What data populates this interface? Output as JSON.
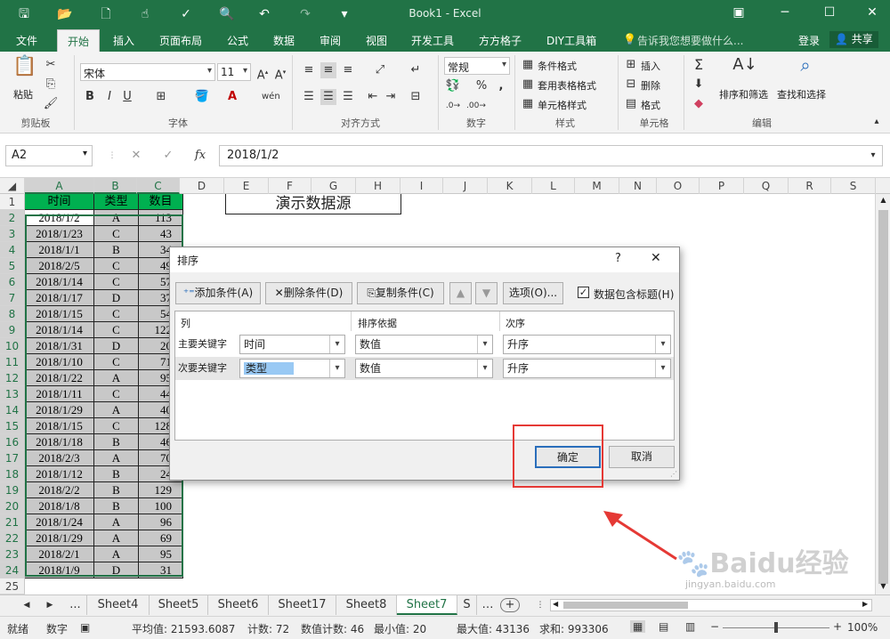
{
  "window": {
    "title": "Book1 - Excel"
  },
  "menu": {
    "tabs": [
      "文件",
      "开始",
      "插入",
      "页面布局",
      "公式",
      "数据",
      "审阅",
      "视图",
      "开发工具",
      "方方格子",
      "DIY工具箱"
    ],
    "tell_me": "告诉我您想要做什么...",
    "login": "登录",
    "share": "共享"
  },
  "ribbon": {
    "paste": "粘贴",
    "clipboard": "剪贴板",
    "font_name": "宋体",
    "font_size": "11",
    "font_group": "字体",
    "align_group": "对齐方式",
    "number_format": "常规",
    "number_group": "数字",
    "cond_format": "条件格式",
    "table_format": "套用表格格式",
    "cell_style": "单元格样式",
    "style_group": "样式",
    "insert": "插入",
    "delete": "删除",
    "format": "格式",
    "cells_group": "单元格",
    "sort_filter": "排序和筛选",
    "find_select": "查找和选择",
    "edit_group": "编辑"
  },
  "formula_bar": {
    "name_box": "A2",
    "formula": "2018/1/2"
  },
  "sheet": {
    "columns": [
      "A",
      "B",
      "C",
      "D",
      "E",
      "F",
      "G",
      "H",
      "I",
      "J",
      "K",
      "L",
      "M",
      "N",
      "O",
      "P",
      "Q",
      "R",
      "S"
    ],
    "header": [
      "时间",
      "类型",
      "数目"
    ],
    "rows": [
      [
        "2018/1/2",
        "A",
        "113"
      ],
      [
        "2018/1/23",
        "C",
        "43"
      ],
      [
        "2018/1/1",
        "B",
        "34"
      ],
      [
        "2018/2/5",
        "C",
        "49"
      ],
      [
        "2018/1/14",
        "C",
        "57"
      ],
      [
        "2018/1/17",
        "D",
        "37"
      ],
      [
        "2018/1/15",
        "C",
        "54"
      ],
      [
        "2018/1/14",
        "C",
        "122"
      ],
      [
        "2018/1/31",
        "D",
        "20"
      ],
      [
        "2018/1/10",
        "C",
        "71"
      ],
      [
        "2018/1/22",
        "A",
        "95"
      ],
      [
        "2018/1/11",
        "C",
        "44"
      ],
      [
        "2018/1/29",
        "A",
        "40"
      ],
      [
        "2018/1/15",
        "C",
        "128"
      ],
      [
        "2018/1/18",
        "B",
        "46"
      ],
      [
        "2018/2/3",
        "A",
        "70"
      ],
      [
        "2018/1/12",
        "B",
        "24"
      ],
      [
        "2018/2/2",
        "B",
        "129"
      ],
      [
        "2018/1/8",
        "B",
        "100"
      ],
      [
        "2018/1/24",
        "A",
        "96"
      ],
      [
        "2018/1/29",
        "A",
        "69"
      ],
      [
        "2018/2/1",
        "A",
        "95"
      ],
      [
        "2018/1/9",
        "D",
        "31"
      ]
    ],
    "row_numbers": [
      "1",
      "2",
      "3",
      "4",
      "5",
      "6",
      "7",
      "8",
      "9",
      "10",
      "11",
      "12",
      "13",
      "14",
      "15",
      "16",
      "17",
      "18",
      "19",
      "20",
      "21",
      "22",
      "23",
      "24",
      "25"
    ],
    "merged_title": "演示数据源"
  },
  "sheet_tabs": {
    "nav": "...",
    "tabs": [
      "Sheet4",
      "Sheet5",
      "Sheet6",
      "Sheet17",
      "Sheet8",
      "Sheet7",
      "S"
    ],
    "active": "Sheet7",
    "add": "+"
  },
  "status": {
    "ready": "就绪",
    "mode": "数字",
    "average": "平均值: 21593.6087",
    "count": "计数: 72",
    "num_count": "数值计数: 46",
    "min": "最小值: 20",
    "max": "最大值: 43136",
    "sum": "求和: 993306",
    "zoom": "100%"
  },
  "dialog": {
    "title": "排序",
    "help": "?",
    "close": "✕",
    "add_level": "添加条件(A)",
    "delete_level": "删除条件(D)",
    "copy_level": "复制条件(C)",
    "options": "选项(O)...",
    "has_headers": "数据包含标题(H)",
    "col_header": "列",
    "sort_on_header": "排序依据",
    "order_header": "次序",
    "levels": [
      {
        "label": "主要关键字",
        "column": "时间",
        "sort_on": "数值",
        "order": "升序"
      },
      {
        "label": "次要关键字",
        "column": "类型",
        "sort_on": "数值",
        "order": "升序"
      }
    ],
    "ok": "确定",
    "cancel": "取消"
  },
  "watermark": {
    "text": "Baidu经验",
    "url": "jingyan.baidu.com"
  },
  "colors": {
    "excel_green": "#217346",
    "header_fill": "#00b050",
    "selection": "#c8c8c8",
    "highlight": "#e53935"
  }
}
